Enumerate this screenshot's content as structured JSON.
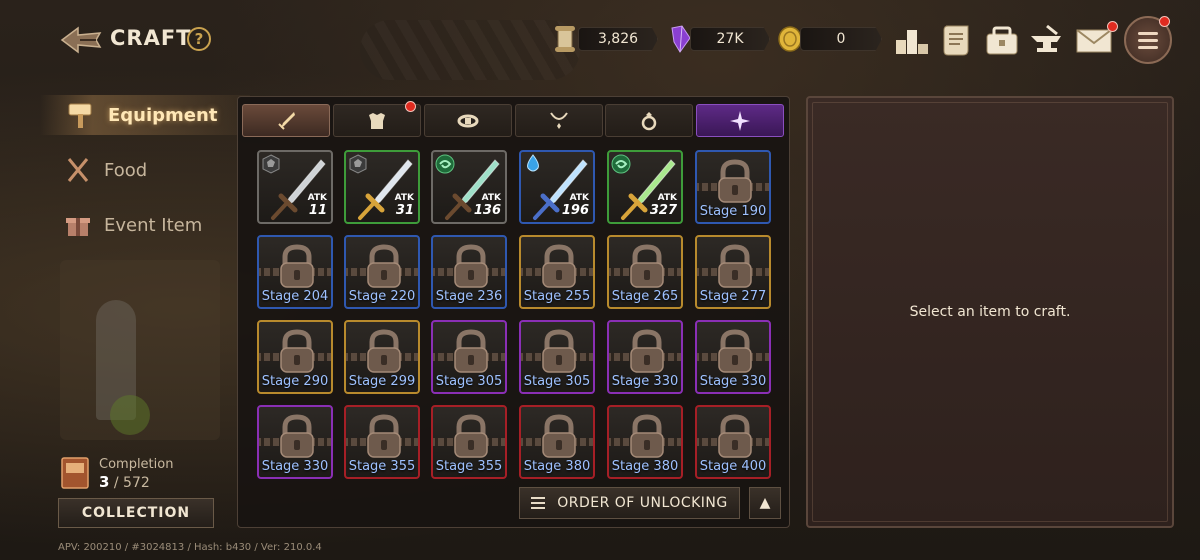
{
  "header": {
    "title": "CRAFT",
    "help_glyph": "?",
    "currencies": [
      {
        "name": "scroll",
        "value": "3,826"
      },
      {
        "name": "crystal",
        "value": "27K"
      },
      {
        "name": "gold",
        "value": "0"
      }
    ],
    "buttons": [
      "ranking-icon",
      "quest-scroll-icon",
      "inventory-chest-icon",
      "anvil-icon",
      "mail-icon",
      "menu-icon"
    ]
  },
  "sidebar": {
    "items": [
      {
        "label": "Equipment",
        "icon": "hammer-icon",
        "active": true
      },
      {
        "label": "Food",
        "icon": "fork-knife-icon",
        "active": false
      },
      {
        "label": "Event Item",
        "icon": "gift-icon",
        "active": false
      }
    ],
    "completion_label": "Completion",
    "completion_current": "3",
    "completion_total": "/ 572",
    "collection_label": "COLLECTION",
    "version": "APV: 200210 / #3024813 / Hash: b430 / Ver: 210.0.4"
  },
  "tabs": [
    {
      "name": "weapon",
      "icon": "sword-icon",
      "active": true
    },
    {
      "name": "armor",
      "icon": "armor-icon",
      "active": false,
      "badge": true
    },
    {
      "name": "belt",
      "icon": "belt-icon",
      "active": false
    },
    {
      "name": "necklace",
      "icon": "necklace-icon",
      "active": false
    },
    {
      "name": "ring",
      "icon": "ring-icon",
      "active": false
    },
    {
      "name": "special",
      "icon": "star-icon",
      "active": false
    }
  ],
  "grid": {
    "unlocked": [
      {
        "atk_label": "ATK",
        "atk": "11",
        "element": "stone",
        "rarity": "grey",
        "blade": "#cfd3d6",
        "hilt": "#6b4a2f"
      },
      {
        "atk_label": "ATK",
        "atk": "31",
        "element": "stone",
        "rarity": "green",
        "blade": "#dfe6ee",
        "hilt": "#d8a43a"
      },
      {
        "atk_label": "ATK",
        "atk": "136",
        "element": "wind",
        "rarity": "grey",
        "blade": "#9fe0c9",
        "hilt": "#6b4a2f"
      },
      {
        "atk_label": "ATK",
        "atk": "196",
        "element": "water",
        "rarity": "blue",
        "blade": "#bfe3ff",
        "hilt": "#4b6fc9"
      },
      {
        "atk_label": "ATK",
        "atk": "327",
        "element": "wind",
        "rarity": "green",
        "blade": "#a9e88e",
        "hilt": "#d8a43a"
      }
    ],
    "locked": [
      {
        "stage": "Stage 190",
        "rarity": "blue"
      },
      {
        "stage": "Stage 204",
        "rarity": "blue"
      },
      {
        "stage": "Stage 220",
        "rarity": "blue"
      },
      {
        "stage": "Stage 236",
        "rarity": "blue"
      },
      {
        "stage": "Stage 255",
        "rarity": "gold"
      },
      {
        "stage": "Stage 265",
        "rarity": "gold"
      },
      {
        "stage": "Stage 277",
        "rarity": "gold"
      },
      {
        "stage": "Stage 290",
        "rarity": "gold"
      },
      {
        "stage": "Stage 299",
        "rarity": "gold"
      },
      {
        "stage": "Stage 305",
        "rarity": "purple"
      },
      {
        "stage": "Stage 305",
        "rarity": "purple"
      },
      {
        "stage": "Stage 330",
        "rarity": "purple"
      },
      {
        "stage": "Stage 330",
        "rarity": "purple"
      },
      {
        "stage": "Stage 330",
        "rarity": "purple"
      },
      {
        "stage": "Stage 355",
        "rarity": "red"
      },
      {
        "stage": "Stage 355",
        "rarity": "red"
      },
      {
        "stage": "Stage 380",
        "rarity": "red"
      },
      {
        "stage": "Stage 380",
        "rarity": "red"
      },
      {
        "stage": "Stage 400",
        "rarity": "red"
      }
    ]
  },
  "controls": {
    "order_label": "ORDER OF UNLOCKING",
    "scroll_up_glyph": "▲"
  },
  "detail": {
    "message": "Select an item to craft."
  }
}
